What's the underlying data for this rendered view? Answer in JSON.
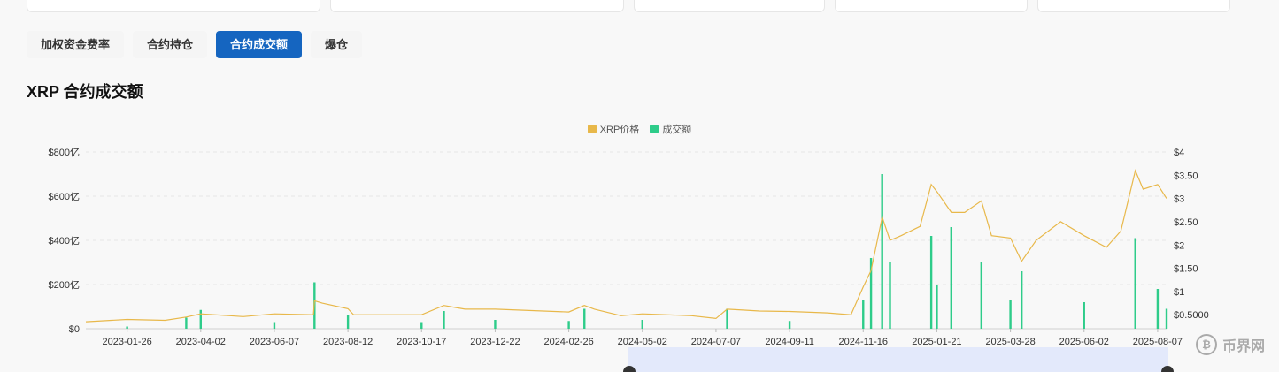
{
  "tabs": [
    {
      "label": "加权资金费率",
      "active": false
    },
    {
      "label": "合约持仓",
      "active": false
    },
    {
      "label": "合约成交额",
      "active": true
    },
    {
      "label": "爆仓",
      "active": false
    }
  ],
  "page_title": "XRP 合约成交额",
  "watermark": {
    "text": "币界网",
    "icon_glyph": "₿"
  },
  "colors": {
    "price": "#e8b84a",
    "volume": "#2ecc8a",
    "accent": "#1565c0",
    "navigator": "#e3e9fb"
  },
  "chart_data": {
    "type": "bar",
    "legend": [
      {
        "name": "XRP价格",
        "color": "#e8b84a"
      },
      {
        "name": "成交额",
        "color": "#2ecc8a"
      }
    ],
    "x_ticks": [
      "2023-01-26",
      "2023-04-02",
      "2023-06-07",
      "2023-08-12",
      "2023-10-17",
      "2023-12-22",
      "2024-02-26",
      "2024-05-02",
      "2024-07-07",
      "2024-09-11",
      "2024-11-16",
      "2025-01-21",
      "2025-03-28",
      "2025-06-02",
      "2025-08-07"
    ],
    "y_left_ticks": [
      "$0",
      "$200亿",
      "$400亿",
      "$600亿",
      "$800亿"
    ],
    "y_left_range": [
      0,
      800
    ],
    "y_right_ticks": [
      "$0.5000",
      "$1",
      "$1.50",
      "$2",
      "$2.50",
      "$3",
      "$3.50",
      "$4"
    ],
    "y_right_range": [
      0.2,
      4
    ],
    "series": [
      {
        "name": "XRP价格",
        "type": "line",
        "points": [
          [
            "2022-12-20",
            0.35
          ],
          [
            "2023-01-26",
            0.4
          ],
          [
            "2023-03-01",
            0.38
          ],
          [
            "2023-03-20",
            0.45
          ],
          [
            "2023-04-02",
            0.52
          ],
          [
            "2023-05-10",
            0.46
          ],
          [
            "2023-06-07",
            0.52
          ],
          [
            "2023-07-12",
            0.5
          ],
          [
            "2023-07-13",
            0.8
          ],
          [
            "2023-07-20",
            0.75
          ],
          [
            "2023-08-12",
            0.63
          ],
          [
            "2023-08-17",
            0.5
          ],
          [
            "2023-09-20",
            0.5
          ],
          [
            "2023-10-17",
            0.5
          ],
          [
            "2023-11-06",
            0.7
          ],
          [
            "2023-11-25",
            0.62
          ],
          [
            "2023-12-22",
            0.62
          ],
          [
            "2024-02-26",
            0.56
          ],
          [
            "2024-03-11",
            0.7
          ],
          [
            "2024-03-20",
            0.62
          ],
          [
            "2024-04-13",
            0.48
          ],
          [
            "2024-05-02",
            0.52
          ],
          [
            "2024-06-15",
            0.48
          ],
          [
            "2024-07-07",
            0.42
          ],
          [
            "2024-07-17",
            0.62
          ],
          [
            "2024-07-31",
            0.6
          ],
          [
            "2024-08-15",
            0.58
          ],
          [
            "2024-09-11",
            0.57
          ],
          [
            "2024-10-15",
            0.54
          ],
          [
            "2024-11-05",
            0.5
          ],
          [
            "2024-11-16",
            1.1
          ],
          [
            "2024-11-23",
            1.45
          ],
          [
            "2024-12-03",
            2.6
          ],
          [
            "2024-12-10",
            2.1
          ],
          [
            "2024-12-20",
            2.2
          ],
          [
            "2025-01-06",
            2.4
          ],
          [
            "2025-01-16",
            3.3
          ],
          [
            "2025-01-21",
            3.15
          ],
          [
            "2025-02-03",
            2.7
          ],
          [
            "2025-02-15",
            2.7
          ],
          [
            "2025-03-02",
            2.95
          ],
          [
            "2025-03-11",
            2.2
          ],
          [
            "2025-03-28",
            2.15
          ],
          [
            "2025-04-07",
            1.65
          ],
          [
            "2025-04-20",
            2.1
          ],
          [
            "2025-05-12",
            2.5
          ],
          [
            "2025-06-02",
            2.2
          ],
          [
            "2025-06-22",
            1.95
          ],
          [
            "2025-07-05",
            2.3
          ],
          [
            "2025-07-18",
            3.6
          ],
          [
            "2025-07-25",
            3.2
          ],
          [
            "2025-08-07",
            3.3
          ],
          [
            "2025-08-15",
            3.0
          ]
        ]
      },
      {
        "name": "成交额",
        "type": "bar",
        "points": [
          [
            "2023-01-26",
            10
          ],
          [
            "2023-03-20",
            50
          ],
          [
            "2023-04-02",
            85
          ],
          [
            "2023-06-07",
            30
          ],
          [
            "2023-07-13",
            210
          ],
          [
            "2023-08-12",
            60
          ],
          [
            "2023-10-17",
            30
          ],
          [
            "2023-11-06",
            80
          ],
          [
            "2023-12-22",
            40
          ],
          [
            "2024-02-26",
            35
          ],
          [
            "2024-03-11",
            90
          ],
          [
            "2024-05-02",
            40
          ],
          [
            "2024-07-17",
            90
          ],
          [
            "2024-09-11",
            35
          ],
          [
            "2024-11-16",
            130
          ],
          [
            "2024-11-23",
            320
          ],
          [
            "2024-12-03",
            700
          ],
          [
            "2024-12-10",
            300
          ],
          [
            "2025-01-16",
            420
          ],
          [
            "2025-01-21",
            200
          ],
          [
            "2025-02-03",
            460
          ],
          [
            "2025-03-02",
            300
          ],
          [
            "2025-03-28",
            130
          ],
          [
            "2025-04-07",
            260
          ],
          [
            "2025-06-02",
            120
          ],
          [
            "2025-07-18",
            410
          ],
          [
            "2025-08-07",
            180
          ],
          [
            "2025-08-15",
            90
          ]
        ]
      }
    ],
    "grid": true
  }
}
